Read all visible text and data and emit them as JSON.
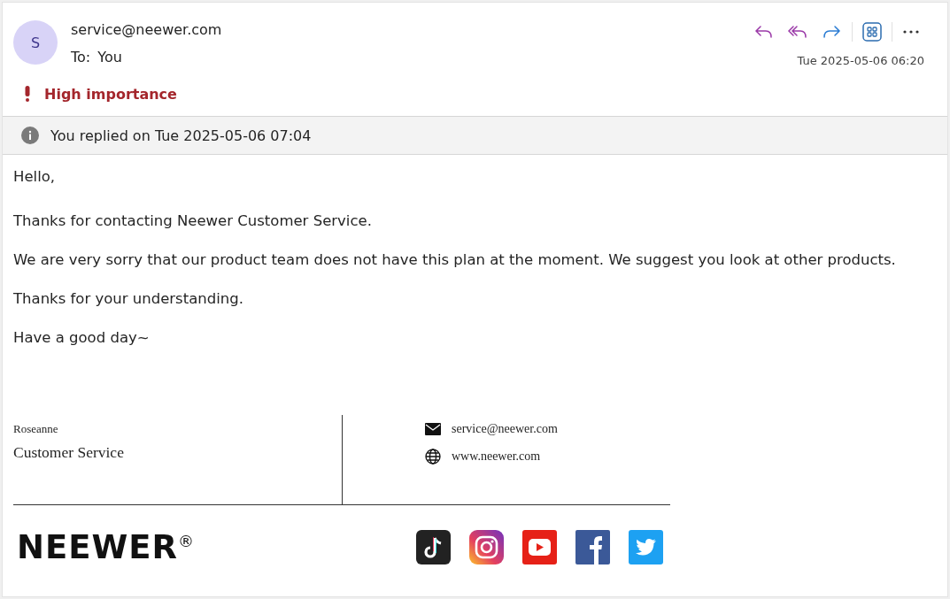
{
  "header": {
    "avatar": "S",
    "sender": "service@neewer.com",
    "to_label": "To:",
    "to": "You",
    "date": "Tue 2025-05-06 06:20",
    "actions": [
      {
        "kind": "reply"
      },
      {
        "kind": "reply-all"
      },
      {
        "kind": "forward"
      },
      {
        "kind": "apps"
      },
      {
        "kind": "more"
      }
    ]
  },
  "importance": {
    "high": true,
    "label": "High importance"
  },
  "info_bar": "You replied on Tue 2025-05-06 07:04",
  "body": [
    "Hello,",
    "Thanks for contacting Neewer Customer Service.",
    "We are very sorry that our product team does not have this plan at the moment. We suggest you look at other products.",
    "Thanks for your understanding.",
    "Have a good day~"
  ],
  "signature": {
    "name": "Roseanne",
    "role": "Customer Service",
    "contacts": [
      {
        "kind": "mail",
        "text": "service@neewer.com"
      },
      {
        "kind": "web",
        "text": "www.neewer.com"
      }
    ],
    "logo": "NEEWER$^{®}$",
    "social": [
      {
        "kind": "tiktok"
      },
      {
        "kind": "instagram"
      },
      {
        "kind": "youtube"
      },
      {
        "kind": "facebook"
      },
      {
        "kind": "twitter"
      }
    ]
  }
}
